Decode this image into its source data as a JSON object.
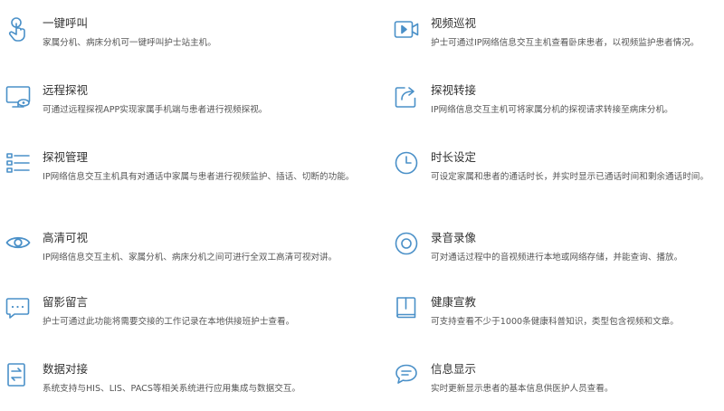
{
  "features": {
    "left": [
      {
        "icon": "tap-finger-icon",
        "title": "一键呼叫",
        "desc": "家属分机、病床分机可一键呼叫护士站主机。"
      },
      {
        "icon": "monitor-eye-icon",
        "title": "远程探视",
        "desc": "可通过远程探视APP实现家属手机端与患者进行视频探视。"
      },
      {
        "icon": "list-manage-icon",
        "title": "探视管理",
        "desc": "IP网络信息交互主机具有对通话中家属与患者进行视频监护、插话、切断的功能。"
      },
      {
        "icon": "eye-icon",
        "title": "高清可视",
        "desc": "IP网络信息交互主机、家属分机、病床分机之间可进行全双工高清可视对讲。"
      },
      {
        "icon": "message-dots-icon",
        "title": "留影留言",
        "desc": "护士可通过此功能将需要交接的工作记录在本地供接班护士查看。"
      },
      {
        "icon": "data-exchange-icon",
        "title": "数据对接",
        "desc": "系统支持与HIS、LIS、PACS等相关系统进行应用集成与数据交互。"
      }
    ],
    "right": [
      {
        "icon": "video-camera-icon",
        "title": "视频巡视",
        "desc": "护士可通过IP网络信息交互主机查看卧床患者，以视频监护患者情况。"
      },
      {
        "icon": "share-transfer-icon",
        "title": "探视转接",
        "desc": "IP网络信息交互主机可将家属分机的探视请求转接至病床分机。"
      },
      {
        "icon": "clock-icon",
        "title": "时长设定",
        "desc": "可设定家属和患者的通话时长，并实时显示已通话时间和剩余通话时间。"
      },
      {
        "icon": "record-icon",
        "title": "录音录像",
        "desc": "可对通话过程中的音视频进行本地或网络存储，并能查询、播放。"
      },
      {
        "icon": "book-icon",
        "title": "健康宣教",
        "desc": "可支持查看不少于1000条健康科普知识，类型包含视频和文章。"
      },
      {
        "icon": "chat-info-icon",
        "title": "信息显示",
        "desc": "实时更新显示患者的基本信息供医护人员查看。"
      }
    ]
  },
  "colors": {
    "icon": "#4a90c8",
    "title": "#333333",
    "desc": "#555555"
  }
}
